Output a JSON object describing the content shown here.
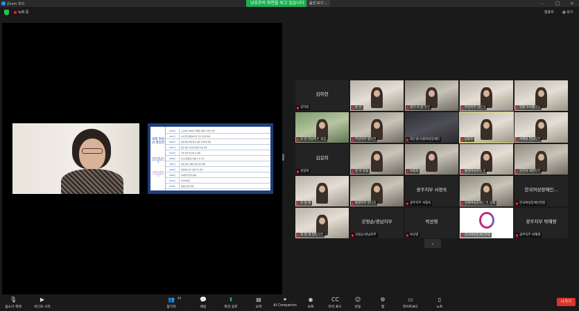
{
  "window": {
    "title": "Zoom 회의"
  },
  "banner": {
    "sharing_text": "냥효주의 화면을 보고 있습니다",
    "view_options": "옵션 보기"
  },
  "topbar": {
    "recording_label": "녹화 중",
    "speaker_view": "발표자",
    "view_label": "보기"
  },
  "slide": {
    "side_title": "세계 여성의 발정권",
    "side_sub": "장애여성의 발판 나아가 발전된 리더",
    "side_sub2": "자료에서 찾아보는 주요 발판 역사",
    "rows": [
      {
        "year": "1954년",
        "text": "노동부와 1998년 법제화 여성의 기초적 권리"
      },
      {
        "year": "1957년",
        "text": "1차 헌법 개정에 의한 국민 기본권 확보"
      },
      {
        "year": "1963년",
        "text": "여성 참여 확대 최초 여성 국회의원 배출"
      },
      {
        "year": "1967년",
        "text": "상동 제도적 여성 참정권 보장 강화"
      },
      {
        "year": "1973년",
        "text": "가족 관련 법 정비 및 개정"
      },
      {
        "year": "1984년",
        "text": "남녀고용평등법 제정 논의 시작"
      },
      {
        "year": "1987년",
        "text": "여성 관련 단체의 정치 참여 확대"
      },
      {
        "year": "1991년",
        "text": "지방의회 선거 여성 후보 증가"
      },
      {
        "year": "1995년",
        "text": "여성발전기본법 제정"
      },
      {
        "year": "2005년",
        "text": "호주제 폐지"
      },
      {
        "year": "2018년",
        "text": "성평등 정책 강화"
      }
    ]
  },
  "gallery": {
    "tiles": [
      {
        "name": "김하현",
        "label": "김하현",
        "type": "name"
      },
      {
        "name": "",
        "label": "손 은",
        "type": "img"
      },
      {
        "name": "",
        "label": "경기 이 일 지부",
        "type": "img"
      },
      {
        "name": "",
        "label": "부산지부 김은하",
        "type": "img"
      },
      {
        "name": "",
        "label": "장애 수어통역사",
        "type": "img"
      },
      {
        "name": "",
        "label": "고 민 전남지부 회장",
        "type": "img"
      },
      {
        "name": "",
        "label": "부산지부 정지연",
        "type": "img"
      },
      {
        "name": "",
        "label": "최은경/서울여성장애인",
        "type": "dark"
      },
      {
        "name": "",
        "label": "냥효주",
        "type": "img"
      },
      {
        "name": "",
        "label": "서혜원 전남지부",
        "type": "img"
      },
      {
        "name": "김길희",
        "label": "김길희",
        "type": "name"
      },
      {
        "name": "",
        "label": "진 우 유휴",
        "type": "img"
      },
      {
        "name": "",
        "label": "박정희",
        "type": "img"
      },
      {
        "name": "",
        "label": "통영여성연대 문",
        "type": "img"
      },
      {
        "name": "",
        "label": "문진희 대전지부",
        "type": "img"
      },
      {
        "name": "",
        "label": "전 정 환",
        "type": "img"
      },
      {
        "name": "",
        "label": "통영지부 문미진",
        "type": "img"
      },
      {
        "name": "광주지부 서정숙",
        "label": "광주지부 서정숙",
        "type": "name"
      },
      {
        "name": "",
        "label": "장애여성장애인 연 합회",
        "type": "img"
      },
      {
        "name": "한국여성장애인...",
        "label": "한국여성장애인연합",
        "type": "name"
      },
      {
        "name": "",
        "label": "최 영 경 전북지부",
        "type": "img"
      },
      {
        "name": "강정순/경남지부",
        "label": "강정순/경남지부",
        "type": "name"
      },
      {
        "name": "박선영",
        "label": "박선영",
        "type": "name"
      },
      {
        "name": "",
        "label": "한국여성장애인연합",
        "type": "logo"
      },
      {
        "name": "광주지부 박혜영",
        "label": "광주지부 박혜영",
        "type": "name"
      }
    ]
  },
  "toolbar": {
    "mute": "음소거 해제",
    "video": "비디오 시작",
    "participants": "참가자",
    "participants_count": "44",
    "chat": "채팅",
    "share": "화면 공유",
    "summary": "요약",
    "ai": "AI Companion",
    "record": "녹화",
    "captions": "자막 표시",
    "reactions": "반응",
    "apps": "앱",
    "whiteboard": "화이트보드",
    "notes": "노트",
    "leave": "나가기"
  }
}
